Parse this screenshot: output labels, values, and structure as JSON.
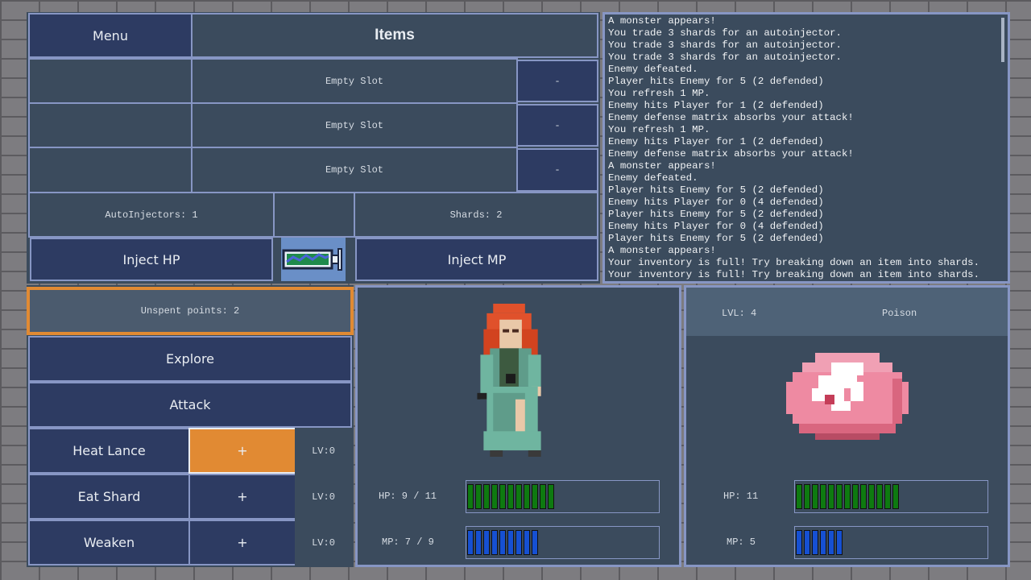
{
  "items_panel": {
    "menu_label": "Menu",
    "title": "Items",
    "slots": [
      {
        "label": "Empty Slot",
        "action": "-"
      },
      {
        "label": "Empty Slot",
        "action": "-"
      },
      {
        "label": "Empty Slot",
        "action": "-"
      }
    ],
    "autoinjectors_text": "AutoInjectors: 1",
    "shards_text": "Shards: 2",
    "inject_hp_label": "Inject HP",
    "inject_mp_label": "Inject MP"
  },
  "log": {
    "lines": [
      "A monster appears!",
      "You trade 3 shards for an autoinjector.",
      "You trade 3 shards for an autoinjector.",
      "You trade 3 shards for an autoinjector.",
      "Enemy defeated.",
      "Player hits Enemy for 5 (2 defended)",
      "You refresh 1 MP.",
      "Enemy hits Player for 1 (2 defended)",
      "Enemy defense matrix absorbs your attack!",
      "You refresh 1 MP.",
      "Enemy hits Player for 1 (2 defended)",
      "Enemy defense matrix absorbs your attack!",
      "A monster appears!",
      "Enemy defeated.",
      "Player hits Enemy for 5 (2 defended)",
      "Enemy hits Player for 0 (4 defended)",
      "Player hits Enemy for 5 (2 defended)",
      "Enemy hits Player for 0 (4 defended)",
      "Player hits Enemy for 5 (2 defended)",
      "A monster appears!",
      "Your inventory is full! Try breaking down an item into shards.",
      "Your inventory is full! Try breaking down an item into shards."
    ]
  },
  "actions": {
    "unspent_points_text": "Unspent points: 2",
    "explore_label": "Explore",
    "attack_label": "Attack",
    "skills": [
      {
        "name": "Heat Lance",
        "plus": "+",
        "level": "LV:0",
        "highlighted": true
      },
      {
        "name": "Eat Shard",
        "plus": "+",
        "level": "LV:0",
        "highlighted": false
      },
      {
        "name": "Weaken",
        "plus": "+",
        "level": "LV:0",
        "highlighted": false
      }
    ]
  },
  "player": {
    "hp_text": "HP: 9 / 11",
    "mp_text": "MP: 7 / 9",
    "hp_fraction": 0.818,
    "mp_fraction": 0.778,
    "hp_segments": 11,
    "mp_segments": 9
  },
  "enemy": {
    "level_text": "LVL: 4",
    "name": "Poison",
    "hp_text": "HP: 11",
    "mp_text": "MP: 5",
    "hp_segments": 13,
    "mp_segments": 6
  },
  "colors": {
    "hp": "#0e7a10",
    "mp": "#1650d2",
    "highlight": "#e18a33"
  }
}
